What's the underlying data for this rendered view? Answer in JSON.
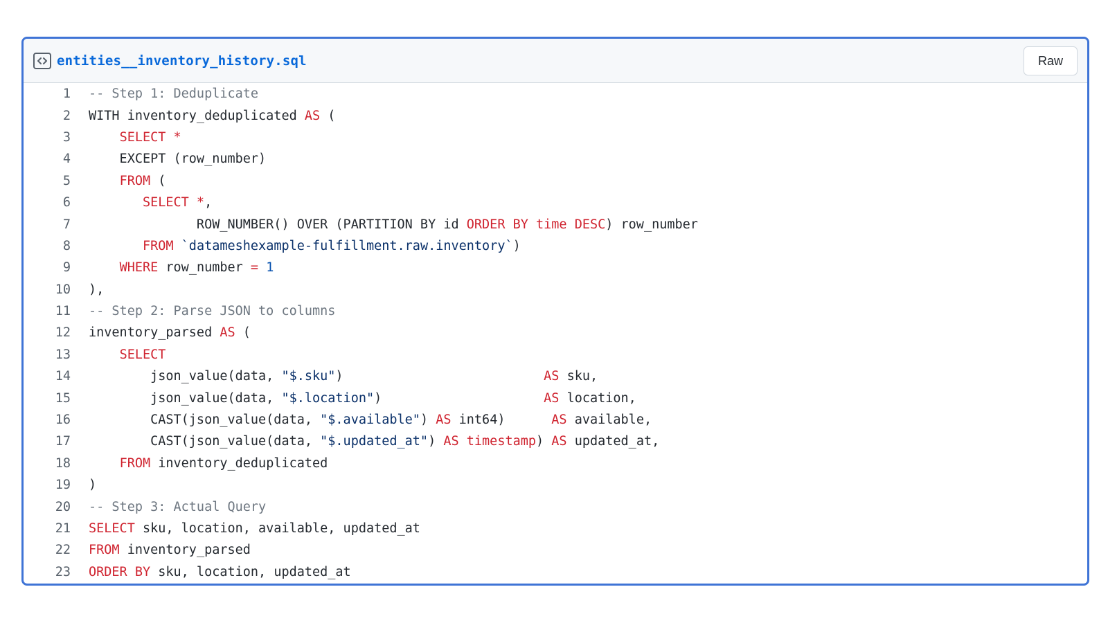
{
  "file": {
    "name": "entities__inventory_history.sql",
    "icon": "code-file-icon",
    "raw_label": "Raw"
  },
  "colors": {
    "border_accent": "#3f74d6",
    "filename": "#0969da",
    "keyword": "#cf222e",
    "string": "#0a3069",
    "number": "#0550ae",
    "comment": "#6e7781",
    "line_number": "#57606a",
    "header_bg": "#f6f8fa"
  },
  "lines": [
    {
      "n": "1",
      "tokens": [
        {
          "t": "c",
          "v": "-- Step 1: Deduplicate"
        }
      ]
    },
    {
      "n": "2",
      "tokens": [
        {
          "t": "p",
          "v": "WITH inventory_deduplicated "
        },
        {
          "t": "k",
          "v": "AS"
        },
        {
          "t": "p",
          "v": " ("
        }
      ]
    },
    {
      "n": "3",
      "tokens": [
        {
          "t": "p",
          "v": "    "
        },
        {
          "t": "k",
          "v": "SELECT *"
        }
      ]
    },
    {
      "n": "4",
      "tokens": [
        {
          "t": "p",
          "v": "    EXCEPT (row_number)"
        }
      ]
    },
    {
      "n": "5",
      "tokens": [
        {
          "t": "p",
          "v": "    "
        },
        {
          "t": "k",
          "v": "FROM"
        },
        {
          "t": "p",
          "v": " ("
        }
      ]
    },
    {
      "n": "6",
      "tokens": [
        {
          "t": "p",
          "v": "       "
        },
        {
          "t": "k",
          "v": "SELECT *"
        },
        {
          "t": "p",
          "v": ","
        }
      ]
    },
    {
      "n": "7",
      "tokens": [
        {
          "t": "p",
          "v": "              ROW_NUMBER() OVER (PARTITION BY id "
        },
        {
          "t": "k",
          "v": "ORDER BY time DESC"
        },
        {
          "t": "p",
          "v": ") row_number"
        }
      ]
    },
    {
      "n": "8",
      "tokens": [
        {
          "t": "p",
          "v": "       "
        },
        {
          "t": "k",
          "v": "FROM"
        },
        {
          "t": "p",
          "v": " "
        },
        {
          "t": "s",
          "v": "`datameshexample-fulfillment.raw.inventory`"
        },
        {
          "t": "p",
          "v": ")"
        }
      ]
    },
    {
      "n": "9",
      "tokens": [
        {
          "t": "p",
          "v": "    "
        },
        {
          "t": "k",
          "v": "WHERE"
        },
        {
          "t": "p",
          "v": " row_number "
        },
        {
          "t": "k",
          "v": "="
        },
        {
          "t": "p",
          "v": " "
        },
        {
          "t": "n",
          "v": "1"
        }
      ]
    },
    {
      "n": "10",
      "tokens": [
        {
          "t": "p",
          "v": "),"
        }
      ]
    },
    {
      "n": "11",
      "tokens": [
        {
          "t": "c",
          "v": "-- Step 2: Parse JSON to columns"
        }
      ]
    },
    {
      "n": "12",
      "tokens": [
        {
          "t": "p",
          "v": "inventory_parsed "
        },
        {
          "t": "k",
          "v": "AS"
        },
        {
          "t": "p",
          "v": " ("
        }
      ]
    },
    {
      "n": "13",
      "tokens": [
        {
          "t": "p",
          "v": "    "
        },
        {
          "t": "k",
          "v": "SELECT"
        }
      ]
    },
    {
      "n": "14",
      "tokens": [
        {
          "t": "p",
          "v": "        json_value(data, "
        },
        {
          "t": "s",
          "v": "\"$.sku\""
        },
        {
          "t": "p",
          "v": ")                          "
        },
        {
          "t": "k",
          "v": "AS"
        },
        {
          "t": "p",
          "v": " sku,"
        }
      ]
    },
    {
      "n": "15",
      "tokens": [
        {
          "t": "p",
          "v": "        json_value(data, "
        },
        {
          "t": "s",
          "v": "\"$.location\""
        },
        {
          "t": "p",
          "v": ")                     "
        },
        {
          "t": "k",
          "v": "AS"
        },
        {
          "t": "p",
          "v": " location,"
        }
      ]
    },
    {
      "n": "16",
      "tokens": [
        {
          "t": "p",
          "v": "        CAST(json_value(data, "
        },
        {
          "t": "s",
          "v": "\"$.available\""
        },
        {
          "t": "p",
          "v": ") "
        },
        {
          "t": "k",
          "v": "AS"
        },
        {
          "t": "p",
          "v": " int64)      "
        },
        {
          "t": "k",
          "v": "AS"
        },
        {
          "t": "p",
          "v": " available,"
        }
      ]
    },
    {
      "n": "17",
      "tokens": [
        {
          "t": "p",
          "v": "        CAST(json_value(data, "
        },
        {
          "t": "s",
          "v": "\"$.updated_at\""
        },
        {
          "t": "p",
          "v": ") "
        },
        {
          "t": "k",
          "v": "AS timestamp"
        },
        {
          "t": "p",
          "v": ") "
        },
        {
          "t": "k",
          "v": "AS"
        },
        {
          "t": "p",
          "v": " updated_at,"
        }
      ]
    },
    {
      "n": "18",
      "tokens": [
        {
          "t": "p",
          "v": "    "
        },
        {
          "t": "k",
          "v": "FROM"
        },
        {
          "t": "p",
          "v": " inventory_deduplicated"
        }
      ]
    },
    {
      "n": "19",
      "tokens": [
        {
          "t": "p",
          "v": ")"
        }
      ]
    },
    {
      "n": "20",
      "tokens": [
        {
          "t": "c",
          "v": "-- Step 3: Actual Query"
        }
      ]
    },
    {
      "n": "21",
      "tokens": [
        {
          "t": "k",
          "v": "SELECT"
        },
        {
          "t": "p",
          "v": " sku, location, available, updated_at"
        }
      ]
    },
    {
      "n": "22",
      "tokens": [
        {
          "t": "k",
          "v": "FROM"
        },
        {
          "t": "p",
          "v": " inventory_parsed"
        }
      ]
    },
    {
      "n": "23",
      "tokens": [
        {
          "t": "k",
          "v": "ORDER BY"
        },
        {
          "t": "p",
          "v": " sku, location, updated_at"
        }
      ]
    }
  ]
}
